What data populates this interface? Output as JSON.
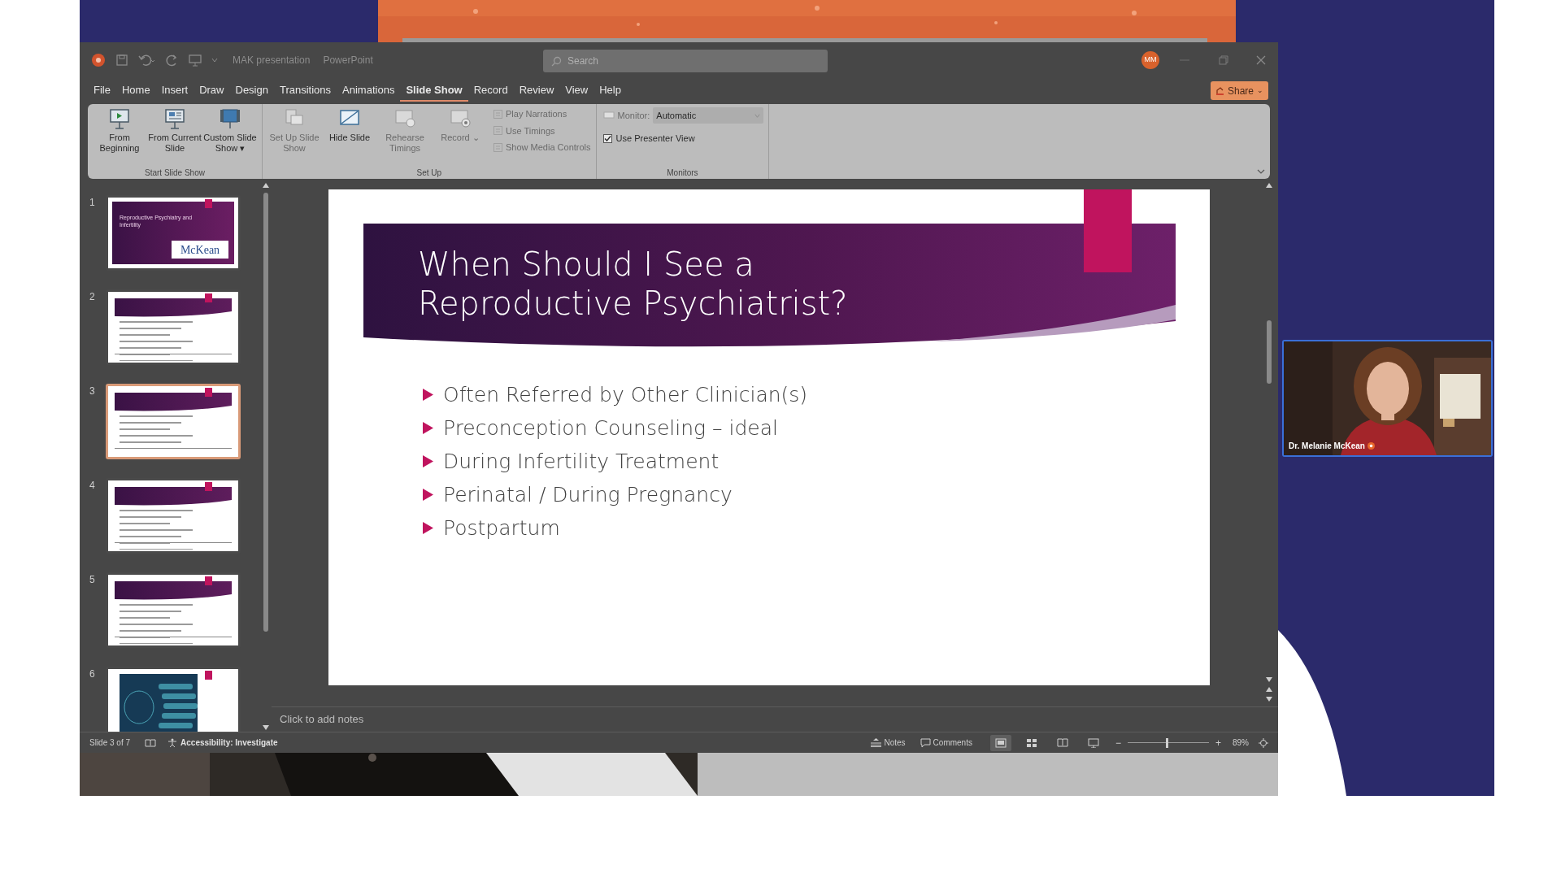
{
  "title_bar": {
    "file_name": "MAK presentation",
    "app_name": "PowerPoint",
    "search_placeholder": "Search",
    "avatar": "MM"
  },
  "menu_tabs": [
    {
      "label": "File",
      "selected": false
    },
    {
      "label": "Home",
      "selected": false
    },
    {
      "label": "Insert",
      "selected": false
    },
    {
      "label": "Draw",
      "selected": false
    },
    {
      "label": "Design",
      "selected": false
    },
    {
      "label": "Transitions",
      "selected": false
    },
    {
      "label": "Animations",
      "selected": false
    },
    {
      "label": "Slide Show",
      "selected": true
    },
    {
      "label": "Record",
      "selected": false
    },
    {
      "label": "Review",
      "selected": false
    },
    {
      "label": "View",
      "selected": false
    },
    {
      "label": "Help",
      "selected": false
    }
  ],
  "share_button": {
    "label": "Share",
    "caret": "⌄"
  },
  "ribbon_groups": [
    {
      "label": "Start Slide Show",
      "items": [
        {
          "kind": "large",
          "label": "From Beginning",
          "disabled": false
        },
        {
          "kind": "large",
          "label": "From Current Slide",
          "disabled": false
        },
        {
          "kind": "large",
          "label": "Custom Slide Show",
          "caret": "▾",
          "disabled": false
        }
      ]
    },
    {
      "label": "Set Up",
      "items": [
        {
          "kind": "large",
          "label": "Set Up Slide Show",
          "disabled": true
        },
        {
          "kind": "large",
          "label": "Hide Slide",
          "disabled": false
        },
        {
          "kind": "large",
          "label": "Rehearse Timings",
          "disabled": true
        },
        {
          "kind": "large",
          "label": "Record",
          "caret": "⌄",
          "disabled": true
        },
        {
          "kind": "option",
          "label": "Play Narrations",
          "disabled": true
        },
        {
          "kind": "option",
          "label": "Use Timings",
          "disabled": true
        },
        {
          "kind": "option",
          "label": "Show Media Controls",
          "disabled": true
        }
      ]
    },
    {
      "label": "Monitors",
      "items": [
        {
          "kind": "dropdown",
          "label": "Monitor:",
          "value": "Automatic",
          "disabled": true
        },
        {
          "kind": "checkbox",
          "label": "Use Presenter View",
          "checked": true,
          "disabled": false
        }
      ]
    }
  ],
  "slides": [
    {
      "number": "1",
      "kind": "title",
      "title": "Reproductive Psychiatry and Infertility",
      "logo": "McKean",
      "selected": false
    },
    {
      "number": "2",
      "kind": "content",
      "selected": false
    },
    {
      "number": "3",
      "kind": "content",
      "selected": true
    },
    {
      "number": "4",
      "kind": "content",
      "selected": false
    },
    {
      "number": "5",
      "kind": "content",
      "selected": false
    },
    {
      "number": "6",
      "kind": "diagram",
      "selected": false
    }
  ],
  "slide": {
    "title_lines": [
      "When Should I See a",
      "Reproductive Psychiatrist?"
    ],
    "bullets": [
      "Often Referred by Other Clinician(s)",
      "Preconception Counseling – ideal",
      "During Infertility Treatment",
      "Perinatal / During Pregnancy",
      "Postpartum"
    ]
  },
  "notes_placeholder": "Click to add notes",
  "status_bar": {
    "slide_counter": "Slide 3 of 7",
    "accessibility": "Accessibility: Investigate",
    "notes": "Notes",
    "comments": "Comments",
    "views": [
      {
        "selected": true
      },
      {
        "selected": false
      },
      {
        "selected": false
      },
      {
        "selected": false
      }
    ],
    "zoom": {
      "level": 0.49,
      "reading": "89%",
      "minus": "−",
      "plus": "+"
    }
  },
  "video_tile": {
    "name": "Dr. Melanie McKean",
    "kind": "picture"
  }
}
